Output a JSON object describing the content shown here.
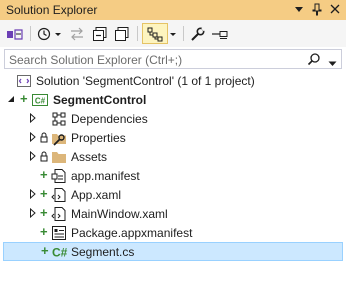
{
  "window": {
    "title": "Solution Explorer",
    "controls": [
      "dropdown-arrow-icon",
      "pin-icon",
      "close-icon"
    ]
  },
  "toolbar": {
    "buttons": [
      "switch-views-icon",
      "home-icon",
      "history-icon",
      "sync-icon",
      "collapse-all-icon",
      "show-all-files-icon",
      "file-nesting-icon",
      "properties-icon",
      "preview-icon"
    ]
  },
  "search": {
    "placeholder": "Search Solution Explorer (Ctrl+;)"
  },
  "tree": {
    "solution": "Solution 'SegmentControl' (1 of 1 project)",
    "project": "SegmentControl",
    "items": [
      {
        "label": "Dependencies",
        "icon": "dependencies-icon"
      },
      {
        "label": "Properties",
        "icon": "wrench-folder-icon"
      },
      {
        "label": "Assets",
        "icon": "folder-icon"
      },
      {
        "label": "app.manifest",
        "icon": "manifest-icon"
      },
      {
        "label": "App.xaml",
        "icon": "xaml-icon"
      },
      {
        "label": "MainWindow.xaml",
        "icon": "xaml-icon"
      },
      {
        "label": "Package.appxmanifest",
        "icon": "package-manifest-icon"
      },
      {
        "label": "Segment.cs",
        "icon": "csharp-file-icon",
        "selected": true
      }
    ]
  },
  "colors": {
    "title_bar": "#f5cc84",
    "toolbar": "#f5f5f5",
    "selection": "#cce8ff",
    "selection_border": "#99d1ff",
    "add_mark": "#388a34",
    "csharp_badge": "#388a34",
    "folder": "#dcb67a"
  }
}
